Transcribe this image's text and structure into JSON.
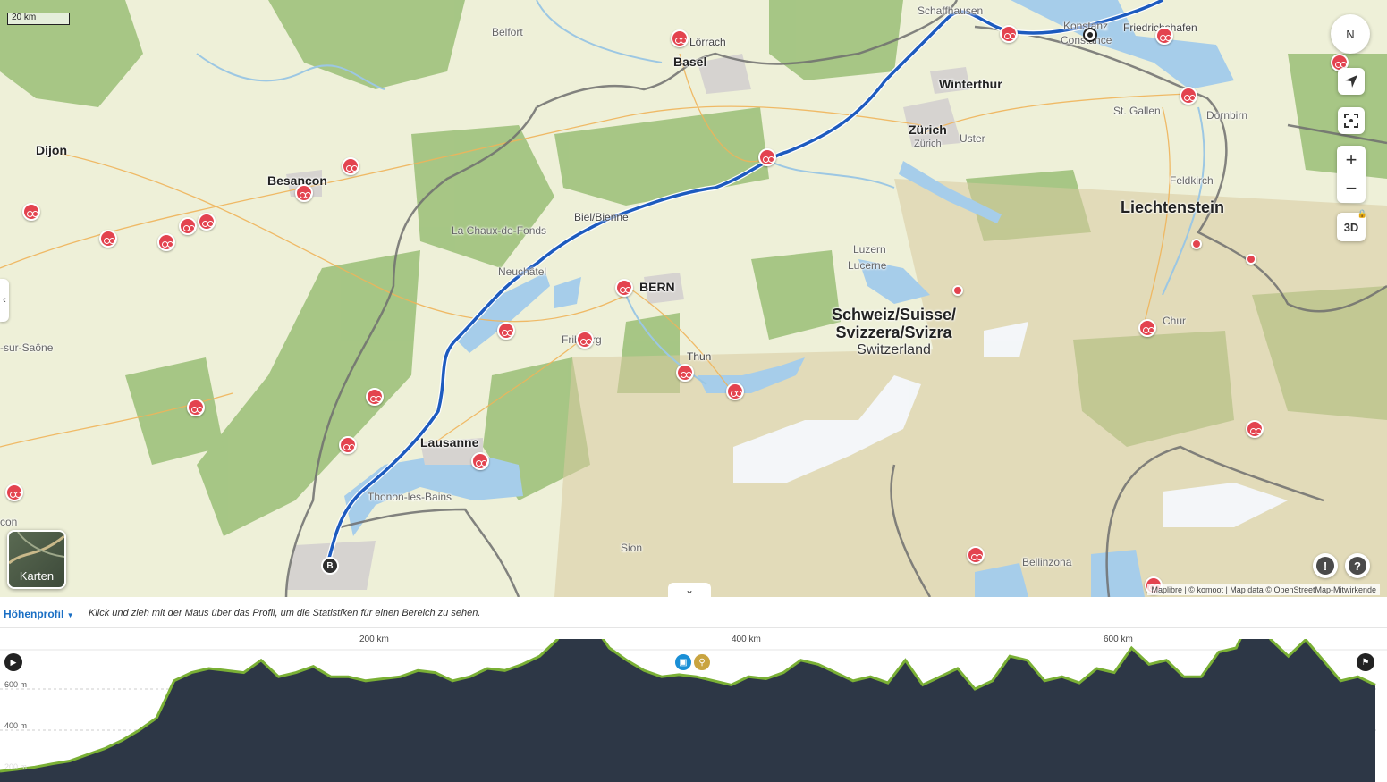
{
  "map": {
    "scale_label": "20 km",
    "places": [
      {
        "id": "schaffhausen",
        "name": "Schaffhausen",
        "cls": "town"
      },
      {
        "id": "konstanz",
        "name": "Konstanz",
        "cls": "town"
      },
      {
        "id": "constance",
        "name": "Constance",
        "cls": "town"
      },
      {
        "id": "friedrichshafen",
        "name": "Friedrichshafen",
        "cls": "town"
      },
      {
        "id": "belfort",
        "name": "Belfort",
        "cls": "town"
      },
      {
        "id": "lorrach",
        "name": "Lörrach",
        "cls": "town"
      },
      {
        "id": "basel",
        "name": "Basel",
        "cls": "city"
      },
      {
        "id": "winterthur",
        "name": "Winterthur",
        "cls": "city"
      },
      {
        "id": "zurich",
        "name": "Zürich",
        "cls": "city"
      },
      {
        "id": "zurich2",
        "name": "Zürich",
        "cls": "town"
      },
      {
        "id": "uster",
        "name": "Uster",
        "cls": "town"
      },
      {
        "id": "stgallen",
        "name": "St. Gallen",
        "cls": "town"
      },
      {
        "id": "dornbirn",
        "name": "Dornbirn",
        "cls": "town"
      },
      {
        "id": "dijon",
        "name": "Dijon",
        "cls": "city"
      },
      {
        "id": "besancon",
        "name": "Besançon",
        "cls": "city"
      },
      {
        "id": "feldkirch",
        "name": "Feldkirch",
        "cls": "town"
      },
      {
        "id": "liechtenstein",
        "name": "Liechtenstein",
        "cls": "region"
      },
      {
        "id": "chauxdefonds",
        "name": "La Chaux-de-Fonds",
        "cls": "town"
      },
      {
        "id": "bielbienne",
        "name": "Biel/Bienne",
        "cls": "town"
      },
      {
        "id": "neuchatel",
        "name": "Neuchâtel",
        "cls": "town"
      },
      {
        "id": "bern",
        "name": "BERN",
        "cls": "city"
      },
      {
        "id": "luzern",
        "name": "Luzern",
        "cls": "town"
      },
      {
        "id": "lucerne",
        "name": "Lucerne",
        "cls": "town"
      },
      {
        "id": "sursaone",
        "name": "-sur-Saône",
        "cls": "town"
      },
      {
        "id": "fribourg",
        "name": "Fribourg",
        "cls": "town"
      },
      {
        "id": "thun",
        "name": "Thun",
        "cls": "town"
      },
      {
        "id": "chur",
        "name": "Chur",
        "cls": "town"
      },
      {
        "id": "lausanne",
        "name": "Lausanne",
        "cls": "city"
      },
      {
        "id": "thonon",
        "name": "Thonon-les-Bains",
        "cls": "town"
      },
      {
        "id": "con",
        "name": "con",
        "cls": "town"
      },
      {
        "id": "sion",
        "name": "Sion",
        "cls": "town"
      },
      {
        "id": "bellinzona",
        "name": "Bellinzona",
        "cls": "town"
      }
    ],
    "country_label": {
      "line1": "Schweiz/Suisse/",
      "line2": "Svizzera/Svizra",
      "line3": "Switzerland"
    },
    "route_start_marker": "B",
    "attribution": "Maplibre | © komoot | Map data © OpenStreetMap-Mitwirkende",
    "karten_label": "Karten",
    "controls": {
      "compass": "N",
      "zoom_in": "+",
      "zoom_out": "−",
      "three_d": "3D",
      "report": "!",
      "help": "?"
    }
  },
  "profile": {
    "title": "Höhenprofil",
    "hint": "Klick und zieh mit der Maus über das Profil, um die Statistiken für einen Bereich zu sehen.",
    "km_ticks": [
      "200 km",
      "400 km",
      "600 km"
    ],
    "elev_ticks": [
      "600 m",
      "400 m",
      "200 m"
    ],
    "colors": {
      "fill": "#2d3746",
      "line": "#7ab035",
      "route": "#1d5bbf",
      "poi": "#e3434f"
    },
    "elevations_m": [
      200,
      205,
      210,
      218,
      225,
      240,
      255,
      275,
      300,
      330,
      420,
      440,
      450,
      445,
      440,
      470,
      430,
      440,
      455,
      430,
      430,
      420,
      425,
      430,
      445,
      440,
      420,
      430,
      450,
      445,
      460,
      480,
      520,
      590,
      560,
      500,
      470,
      445,
      430,
      435,
      430,
      420,
      410,
      430,
      425,
      440,
      470,
      460,
      440,
      420,
      430,
      415,
      470,
      410,
      430,
      450,
      400,
      420,
      480,
      470,
      420,
      430,
      415,
      450,
      440,
      500,
      460,
      470,
      430,
      430,
      490,
      500,
      590,
      520,
      480,
      520,
      470,
      420,
      430,
      410
    ]
  }
}
